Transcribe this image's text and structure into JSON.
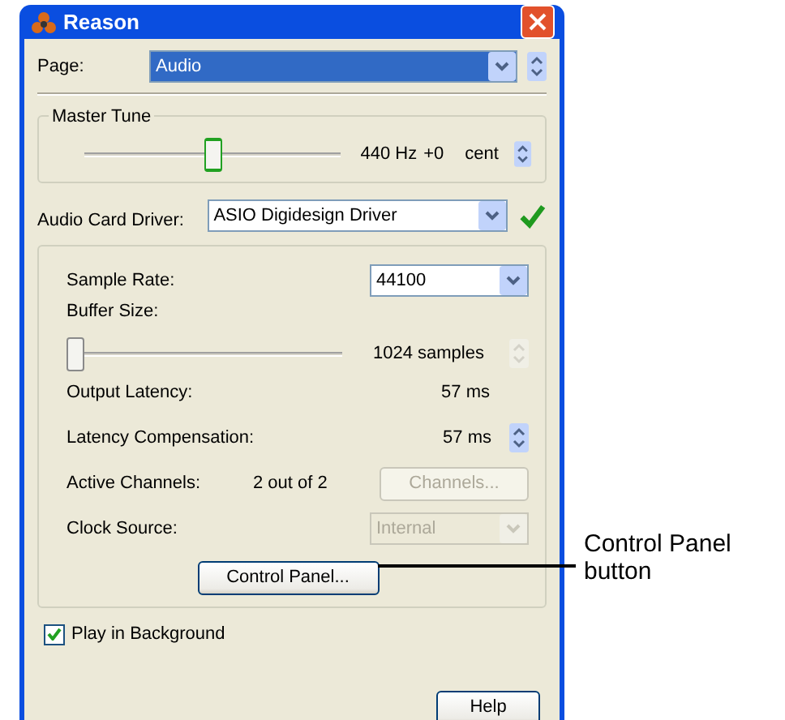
{
  "window": {
    "title": "Reason"
  },
  "page": {
    "label": "Page:",
    "value": "Audio"
  },
  "master_tune": {
    "title": "Master Tune",
    "level": 0.5,
    "reading": "440 Hz",
    "offset": "+0",
    "unit": "cent"
  },
  "driver": {
    "label": "Audio Card Driver:",
    "value": "ASIO Digidesign Driver",
    "ok": true
  },
  "settings": [
    {
      "kind": "select",
      "label": "Sample Rate:",
      "value": "44100",
      "disabled": false
    },
    {
      "kind": "label",
      "label": "Buffer Size:"
    },
    {
      "kind": "slider",
      "level": 0,
      "reading": "1024 samples",
      "disabled": true
    },
    {
      "kind": "value",
      "label": "Output Latency:",
      "value": "57 ms"
    },
    {
      "kind": "spin",
      "label": "Latency Compensation:",
      "value": "57 ms",
      "disabled": false
    },
    {
      "kind": "button",
      "label": "Active Channels:",
      "value": "2 out of 2",
      "button": "Channels...",
      "disabled": true
    },
    {
      "kind": "select",
      "label": "Clock Source:",
      "value": "Internal",
      "disabled": true
    }
  ],
  "control_panel_button": "Control Panel...",
  "play_in_background": {
    "label": "Play in Background",
    "checked": true
  },
  "help_button": "Help",
  "callout": "Control Panel button"
}
